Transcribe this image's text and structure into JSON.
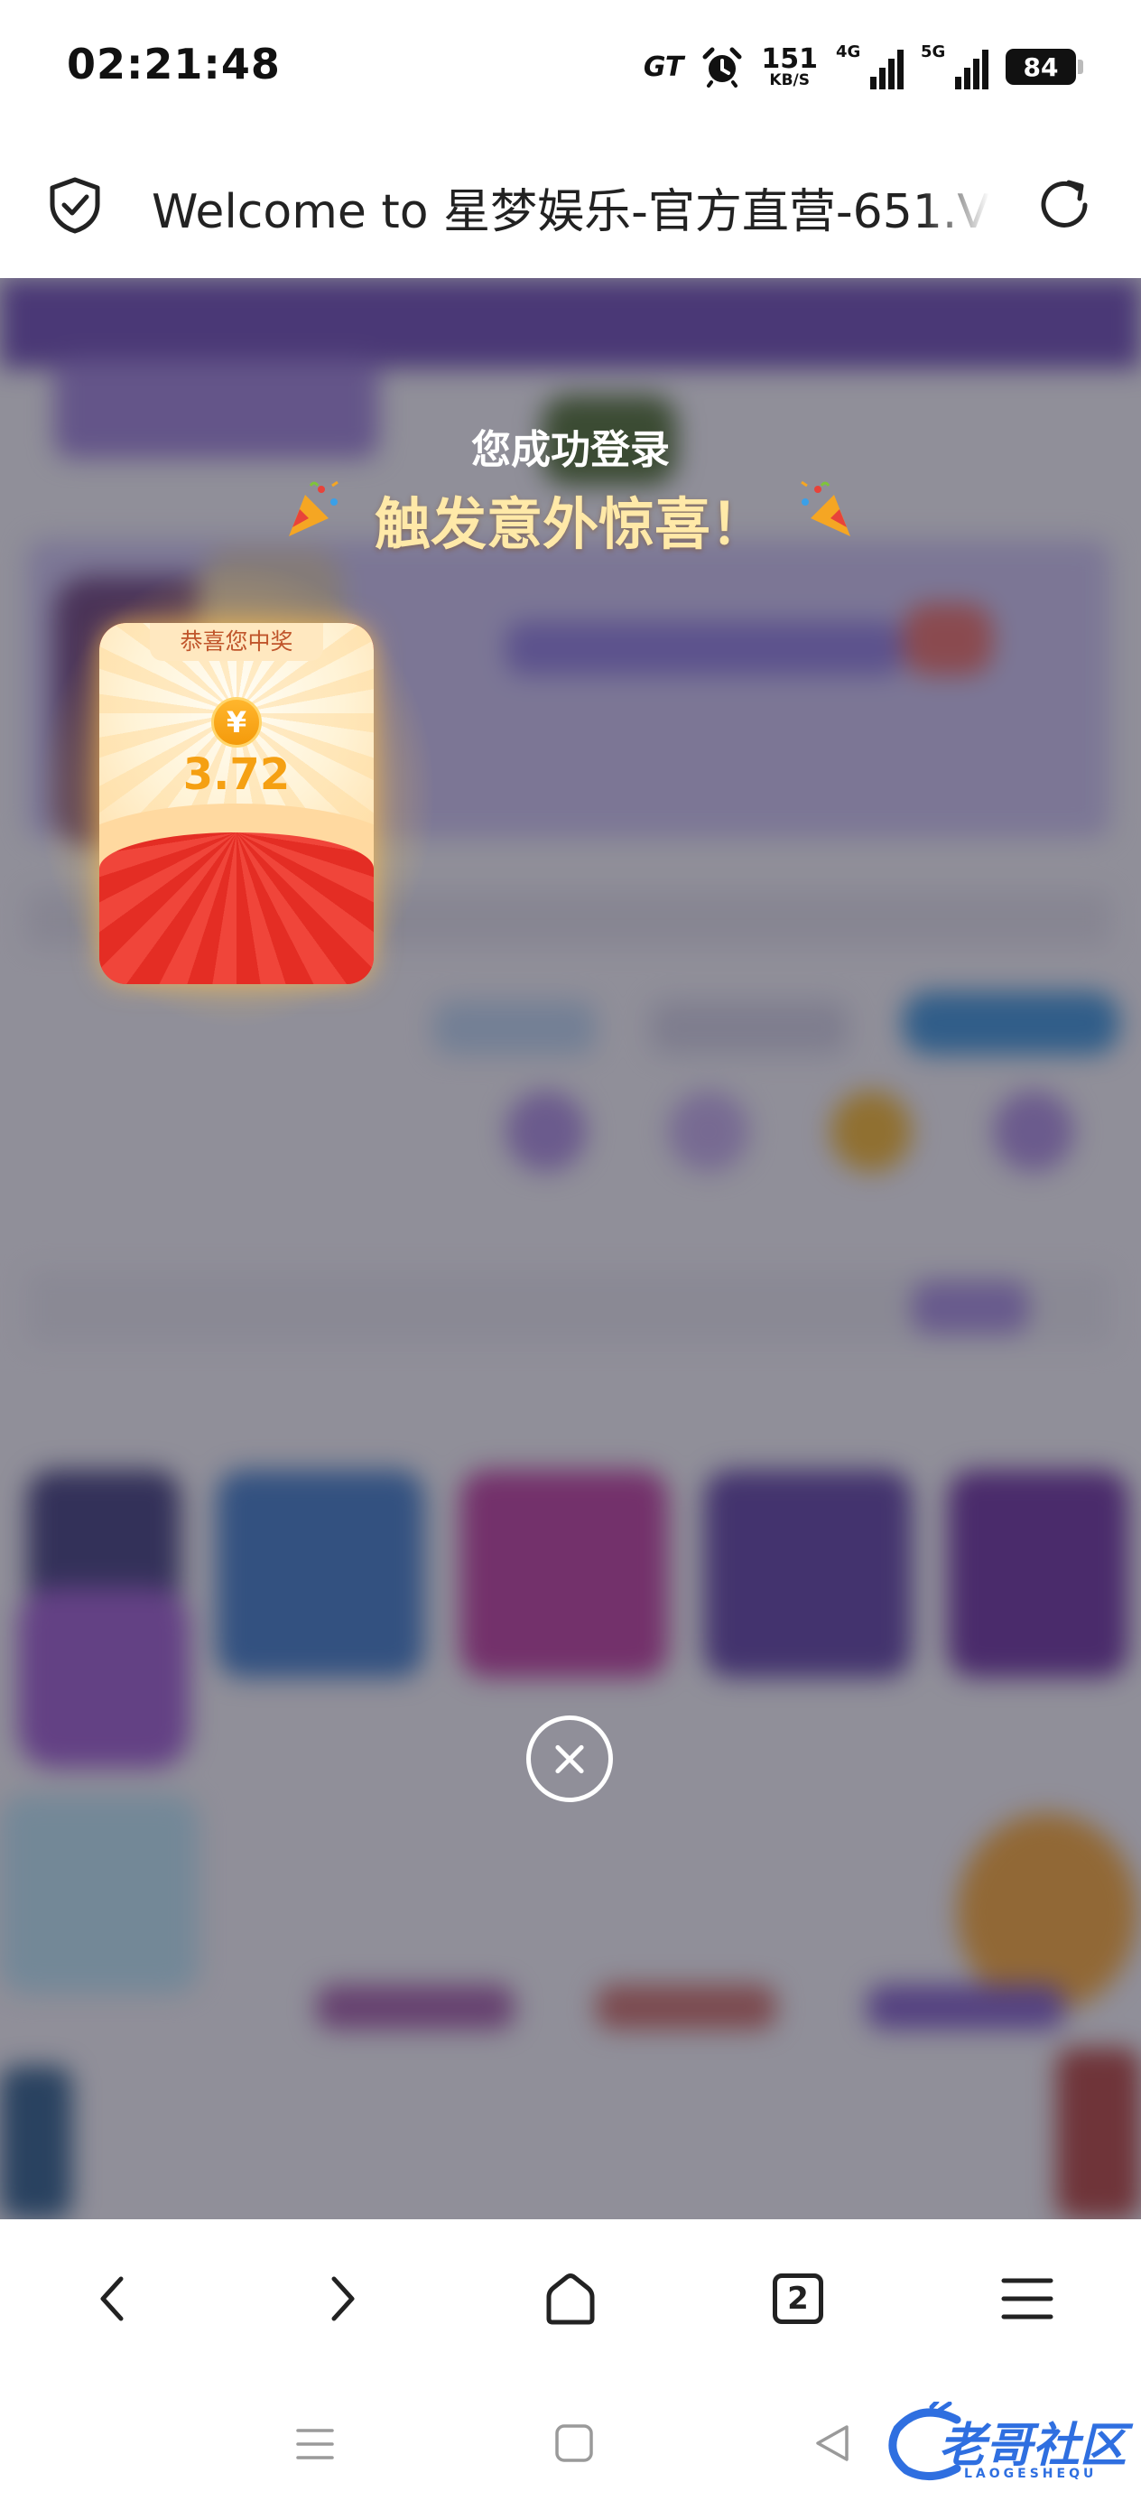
{
  "status_bar": {
    "time": "02:21:48",
    "gt_label": "GT",
    "net_speed_value": "151",
    "net_speed_unit": "KB/S",
    "signal_1_label": "4G",
    "signal_2_label": "5G",
    "battery_level": "84",
    "icons": [
      "gt-icon",
      "alarm-icon",
      "signal-4g-icon",
      "signal-5g-icon",
      "battery-icon"
    ]
  },
  "url_bar": {
    "page_title": "Welcome to 星梦娱乐-官方直营-651.V",
    "icons": [
      "shield-check-icon",
      "reload-icon"
    ]
  },
  "popup": {
    "subtitle": "您成功登录",
    "title": "触发意外惊喜！",
    "envelope_label": "恭喜您中奖",
    "currency_symbol": "¥",
    "amount": "3.72",
    "icons": [
      "party-popper-icon",
      "close-icon"
    ]
  },
  "browser_nav": {
    "tab_count": "2",
    "icons": [
      "back-icon",
      "forward-icon",
      "home-icon",
      "tabs-icon",
      "menu-icon"
    ]
  },
  "system_nav": {
    "watermark_text": "老哥社区",
    "watermark_sub": "LAOGESHEQU",
    "icons": [
      "recents-icon",
      "home-square-icon",
      "back-triangle-icon"
    ]
  },
  "colors": {
    "popup_title": "#ffe9a8",
    "envelope_red": "#e8342a",
    "amount_gold": "#f5a012",
    "watermark_blue": "#2f6fe0"
  }
}
